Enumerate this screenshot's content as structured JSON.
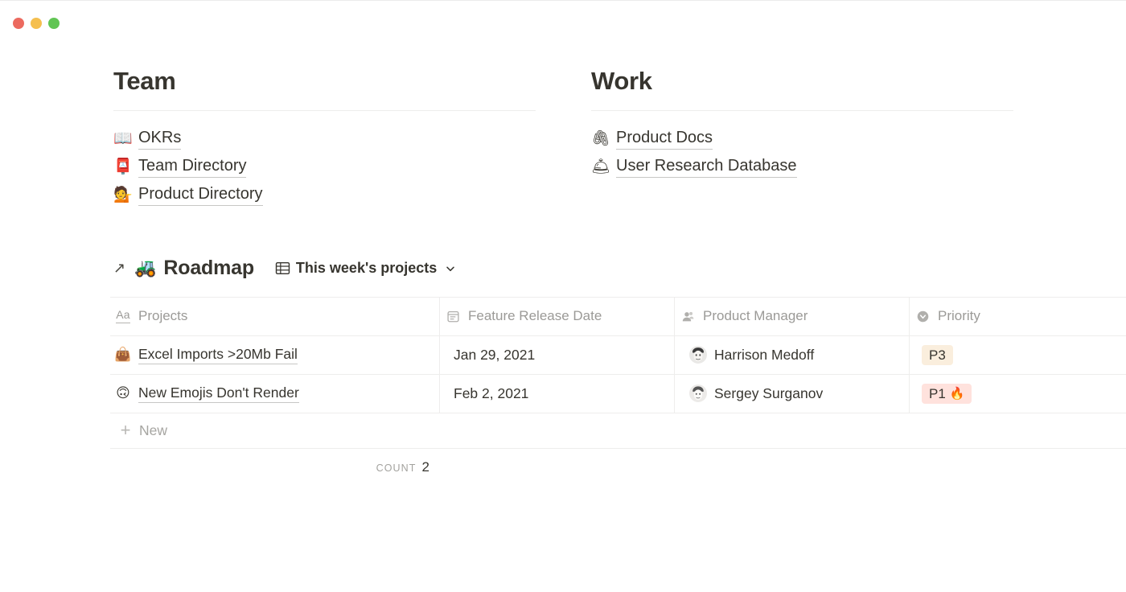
{
  "window": {
    "traffic_lights": [
      {
        "name": "close",
        "color": "#ec6a5f"
      },
      {
        "name": "minimize",
        "color": "#f5bf4f"
      },
      {
        "name": "zoom",
        "color": "#61c554"
      }
    ]
  },
  "sections": [
    {
      "title": "Team",
      "links": [
        {
          "emoji": "📖",
          "icon_name": "open-book-emoji",
          "label": "OKRs"
        },
        {
          "emoji": "📮",
          "icon_name": "postbox-emoji",
          "label": "Team Directory"
        },
        {
          "emoji": "💁",
          "icon_name": "person-tipping-hand-emoji",
          "label": "Product Directory"
        }
      ]
    },
    {
      "title": "Work",
      "links": [
        {
          "emoji": "🖇",
          "icon_name": "linked-paperclips-emoji",
          "label": "Product Docs"
        },
        {
          "emoji": "🛎",
          "icon_name": "bellhop-bell-emoji",
          "label": "User Research Database"
        }
      ]
    }
  ],
  "roadmap": {
    "link_arrow": "↗",
    "emoji": "🚜",
    "icon_name": "tractor-emoji",
    "title": "Roadmap",
    "view_name": "This week's projects",
    "view_icon_name": "table-grid-icon",
    "chevron_icon_name": "chevron-down-icon"
  },
  "table": {
    "columns": [
      {
        "key": "projects",
        "label": "Projects",
        "icon_name": "text-type-icon",
        "icon_glyph": "Aa"
      },
      {
        "key": "date",
        "label": "Feature Release Date",
        "icon_name": "calendar-icon"
      },
      {
        "key": "pm",
        "label": "Product Manager",
        "icon_name": "person-icon"
      },
      {
        "key": "priority",
        "label": "Priority",
        "icon_name": "select-circle-icon"
      }
    ],
    "rows": [
      {
        "emoji": "👜",
        "emoji_name": "handbag-emoji",
        "project": "Excel Imports >20Mb Fail",
        "date": "Jan 29, 2021",
        "manager": "Harrison Medoff",
        "priority": "P3",
        "priority_suffix": "",
        "priority_bg": "#faeedd"
      },
      {
        "emoji": "🙃",
        "emoji_name": "upside-down-face-emoji",
        "project": "New Emojis Don't Render",
        "date": "Feb 2, 2021",
        "manager": "Sergey Surganov",
        "priority": "P1",
        "priority_suffix": "🔥",
        "priority_bg": "#ffe2dd"
      }
    ],
    "new_row_label": "New",
    "new_row_icon_name": "plus-icon",
    "count_label": "Count",
    "count_value": "2"
  }
}
